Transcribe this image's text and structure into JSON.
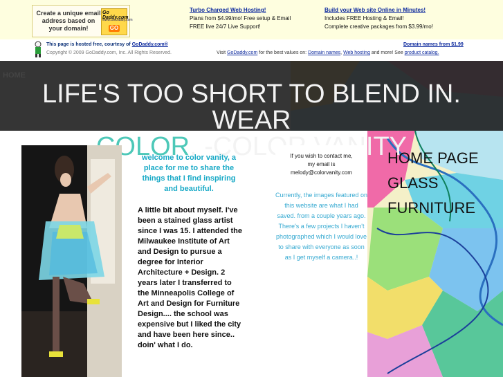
{
  "godaddy_bar": {
    "logo_text": "Create a unique email address based on your domain!",
    "logo_brand": "Go Daddy.com",
    "logo_url": "www.GoDaddy.com",
    "logo_go": "GO",
    "promo1": {
      "title": "Turbo Charged Web Hosting!",
      "line1": "Plans from $4.99/mo! Free setup & Email",
      "line2": "FREE live 24/7 Live Support!"
    },
    "promo2": {
      "title": "Build your Web site Online in Minutes!",
      "line1": "Includes FREE Hosting & Email!",
      "line2": "Complete creative packages from $3.99/mo!"
    }
  },
  "godaddy_strip": {
    "hosted_prefix": "This page is hosted free, courtesy of",
    "hosted_link": "GoDaddy.com®",
    "copyright": "Copyright © 2009 GoDaddy.com, Inc. All Rights Reserved.",
    "domain_offer": "Domain names from $1.99",
    "visit_prefix": "Visit",
    "visit_link": "GoDaddy.com",
    "visit_middle": "for the best values on:",
    "link_domains": "Domain names",
    "link_hosting": "Web hosting",
    "visit_and": "and more! See",
    "link_catalog": "product catalog."
  },
  "nav": {
    "home_link": "HOME"
  },
  "banner": {
    "part1": "LIFE'S TOO SHORT TO BLEND IN. WEAR",
    "color_word": "COLOR",
    "part2": ". -COLOR VANITY"
  },
  "welcome": "welcome to color vanity, a place for me to share the things that I find inspiring and beautiful.",
  "about": "A little bit about myself. I've been a stained glass artist since I was 15. I attended the Milwaukee Institute of Art and Design to pursue a degree for Interior Architecture + Design. 2 years later I transferred to the Minneapolis College of Art and Design for Furniture Design.... the school was expensive but I liked the city and have been here since.. doin' what I do.",
  "contact": {
    "line1": "If you wish to contact me,",
    "line2": "my email is",
    "email": "melody@colorvanity.com"
  },
  "note": "Currently, the images featured on this website are what I had saved. from a couple years ago. There's a few projects I haven't photographed which I would love to share with everyone as soon as I get myself a camera..!",
  "side_nav": {
    "items": [
      "HOME PAGE",
      "GLASS",
      "FURNITURE"
    ]
  },
  "colors": {
    "banner_bg": "#262626",
    "accent": "#4dc8b8",
    "welcome_text": "#17a9c6",
    "note_text": "#35a9d1",
    "link_blue": "#0d2a9e"
  }
}
